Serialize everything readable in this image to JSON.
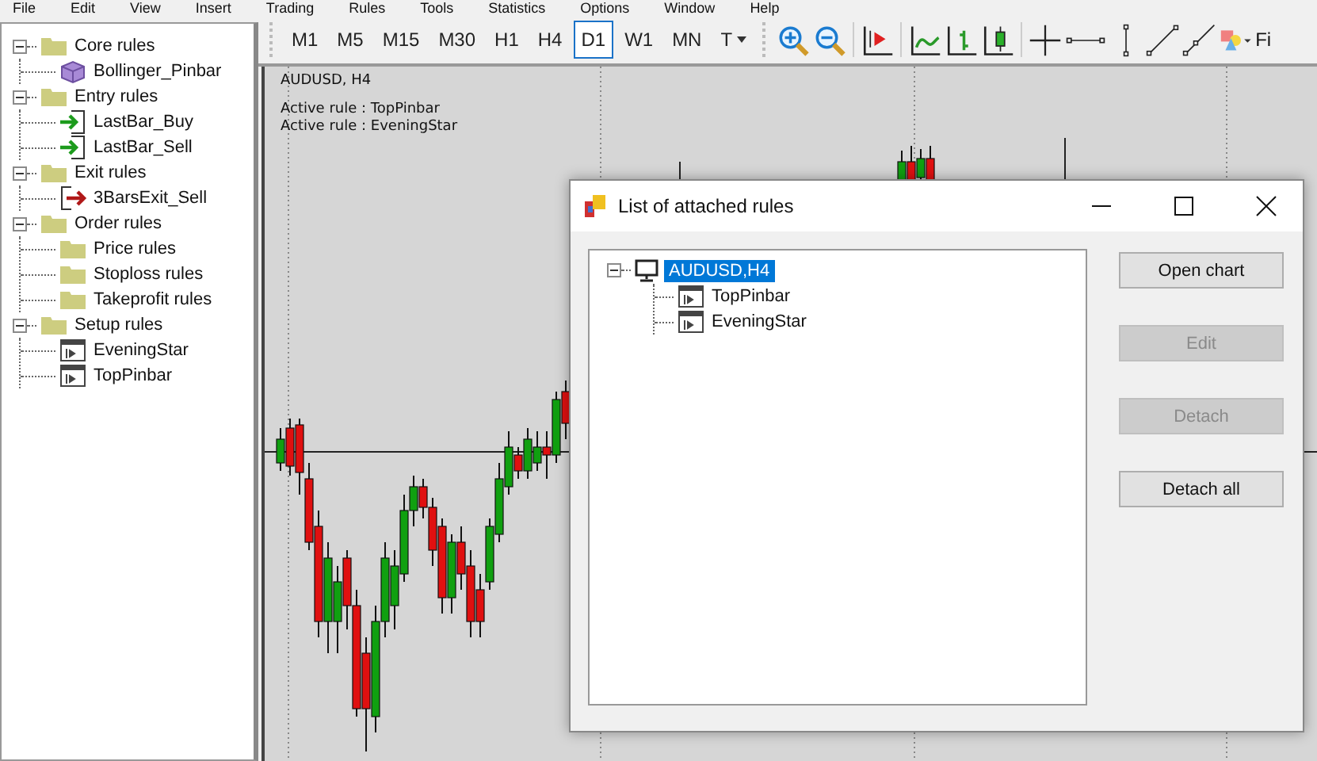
{
  "menu": [
    "File",
    "Edit",
    "View",
    "Insert",
    "Trading",
    "Rules",
    "Tools",
    "Statistics",
    "Options",
    "Window",
    "Help"
  ],
  "rule_tree": [
    {
      "label": "Core rules",
      "kind": "folder",
      "expanded": true,
      "children": [
        {
          "label": "Bollinger_Pinbar",
          "kind": "cube"
        }
      ]
    },
    {
      "label": "Entry rules",
      "kind": "folder",
      "expanded": true,
      "children": [
        {
          "label": "LastBar_Buy",
          "kind": "entry"
        },
        {
          "label": "LastBar_Sell",
          "kind": "entry"
        }
      ]
    },
    {
      "label": "Exit rules",
      "kind": "folder",
      "expanded": true,
      "children": [
        {
          "label": "3BarsExit_Sell",
          "kind": "exit"
        }
      ]
    },
    {
      "label": "Order rules",
      "kind": "folder",
      "expanded": true,
      "children": [
        {
          "label": "Price rules",
          "kind": "folder"
        },
        {
          "label": "Stoploss rules",
          "kind": "folder"
        },
        {
          "label": "Takeprofit rules",
          "kind": "folder"
        }
      ]
    },
    {
      "label": "Setup rules",
      "kind": "folder",
      "expanded": true,
      "children": [
        {
          "label": "EveningStar",
          "kind": "rule"
        },
        {
          "label": "TopPinbar",
          "kind": "rule"
        }
      ]
    }
  ],
  "toolbar": {
    "timeframes": [
      {
        "label": "M1",
        "selected": false
      },
      {
        "label": "M5",
        "selected": false
      },
      {
        "label": "M15",
        "selected": false
      },
      {
        "label": "M30",
        "selected": false
      },
      {
        "label": "H1",
        "selected": false
      },
      {
        "label": "H4",
        "selected": false
      },
      {
        "label": "D1",
        "selected": true
      },
      {
        "label": "W1",
        "selected": false
      },
      {
        "label": "MN",
        "selected": false
      }
    ],
    "template_menu": "T",
    "cut_label": "Fi"
  },
  "chart": {
    "symbol": "AUDUSD, H4",
    "active_rules": [
      "Active rule : TopPinbar",
      "Active rule : EveningStar"
    ]
  },
  "dialog": {
    "title": "List of attached rules",
    "tree": {
      "label": "AUDUSD,H4",
      "selected": true,
      "expanded": true,
      "children": [
        {
          "label": "TopPinbar"
        },
        {
          "label": "EveningStar"
        }
      ]
    },
    "buttons": [
      {
        "label": "Open chart",
        "disabled": false
      },
      {
        "label": "Edit",
        "disabled": true
      },
      {
        "label": "Detach",
        "disabled": true
      },
      {
        "label": "Detach all",
        "disabled": false
      }
    ]
  }
}
